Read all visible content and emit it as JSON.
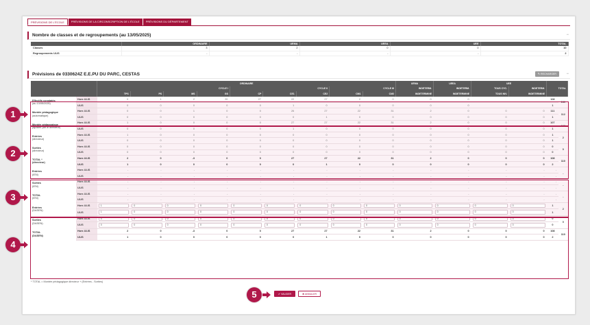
{
  "tabs": [
    {
      "label": "Prévisions de l'école"
    },
    {
      "label": "Prévisions de la circonscription de l'école"
    },
    {
      "label": "Prévisions du département"
    }
  ],
  "section1": {
    "title": "Nombre de classes et de regroupements (au 13/05/2025)",
    "collapse": "−",
    "columns": [
      "",
      "ORDINAIRE",
      "UEMA",
      "UEEA",
      "UEE",
      "TOTAL"
    ],
    "rows": [
      {
        "label": "Classes",
        "values": [
          "3",
          "2",
          "0",
          "0",
          "10"
        ]
      },
      {
        "label": "Regroupements ULIS",
        "values": [
          "-",
          "-",
          "-",
          "-",
          "2"
        ]
      }
    ]
  },
  "section2": {
    "title": "Prévisions de 0330624Z E.E.PU DU PARC, CESTAS",
    "recharger": "Recharger",
    "collapse": "−",
    "header": {
      "group_top": [
        "ORDINAIRE",
        "UEMA",
        "UEEA",
        "UEE",
        "TOTAL"
      ],
      "cycles": [
        "CYCLE I",
        "CYCLE II",
        "CYCLE III",
        "INDETERM.",
        "INDETERM.",
        "TOUS CYC.",
        "INDETERM."
      ],
      "levels": [
        "TPS",
        "PS",
        "MS",
        "GS",
        "CP",
        "CE1",
        "CE2",
        "CM1",
        "CM2",
        "INDETERMINE",
        "INDETERMINE",
        "TOUS NIV.",
        "INDETERMINE"
      ]
    },
    "rows": {
      "constates": {
        "label": "Effectifs constatés",
        "sublabel": "(au 13/05/2025)",
        "hors": [
          "0",
          "1",
          "2",
          "20",
          "27",
          "22",
          "27",
          "2",
          "0",
          "0",
          "0"
        ],
        "ulis": [
          "0",
          "0",
          "0",
          "0",
          "0",
          "1",
          "0",
          "0",
          "0",
          "0",
          "0"
        ],
        "total_h": "108",
        "total_u": "1",
        "total": "139"
      },
      "auto": {
        "label": "Montée pédagogique",
        "sublabel": "(automatique)",
        "hors": [
          "0",
          "0",
          "1",
          "0",
          "0",
          "26",
          "27",
          "22",
          "31",
          "2",
          "0",
          "0",
          "0"
        ],
        "ulis": [
          "0",
          "0",
          "0",
          "0",
          "0",
          "0",
          "1",
          "0",
          "0",
          "0",
          "0",
          "0",
          "0"
        ],
        "total_h": "111",
        "total_u": "1",
        "total": "112"
      }
    },
    "g2": {
      "montee": {
        "label": "Montée pédagogique",
        "sublabel": "(ajustée par le directeur)",
        "hors": [
          "1",
          "0",
          "0",
          "0",
          "0",
          "27",
          "27",
          "22",
          "31",
          "2",
          "0",
          "0",
          "0"
        ],
        "ulis": [
          "0",
          "0",
          "0",
          "0",
          "0",
          "1",
          "0",
          "0",
          "0",
          "0",
          "0",
          "0",
          "0"
        ],
        "total_h": "107",
        "total_u": "1",
        "total": "108"
      },
      "entrees": {
        "label": "Entrées",
        "sublabel": "(directeur)",
        "hors": [
          "1",
          "0",
          "0",
          "0",
          "0",
          "0",
          "0",
          "0",
          "0",
          "0",
          "0",
          "0",
          "0"
        ],
        "ulis": [
          "0",
          "0",
          "0",
          "0",
          "0",
          "0",
          "0",
          "0",
          "0",
          "0",
          "0",
          "0",
          "0"
        ],
        "total_h": "1",
        "total_u": "1",
        "total": "2"
      },
      "sorties": {
        "label": "Sorties",
        "sublabel": "(directeur)",
        "hors": [
          "0",
          "0",
          "0",
          "0",
          "0",
          "0",
          "0",
          "0",
          "0",
          "0",
          "0",
          "0",
          "0"
        ],
        "ulis": [
          "0",
          "0",
          "0",
          "0",
          "0",
          "0",
          "0",
          "0",
          "0",
          "0",
          "0",
          "0",
          "0"
        ],
        "total_h": "0",
        "total_u": "0",
        "total": "0"
      },
      "total": {
        "label": "TOTAL *",
        "sublabel": "(directeur)",
        "hors": [
          "2",
          "0",
          "-3",
          "0",
          "0",
          "27",
          "27",
          "22",
          "31",
          "2",
          "0",
          "0",
          "0"
        ],
        "ulis": [
          "1",
          "0",
          "0",
          "0",
          "0",
          "0",
          "1",
          "0",
          "0",
          "0",
          "0",
          "0",
          "0"
        ],
        "total_h": "108",
        "total_u": "2",
        "total": "110"
      }
    },
    "g3": {
      "rows": [
        {
          "label": "Entrées",
          "sublabel": "(IEN)"
        },
        {
          "label": "Sorties",
          "sublabel": "(IEN)"
        },
        {
          "label": "TOTAL",
          "sublabel": "(IEN)"
        }
      ],
      "dash": "-"
    },
    "g4": {
      "entrees": {
        "label": "Entrées",
        "sublabel": "(DASEN)",
        "hors": [
          "1",
          "0",
          "0",
          "0",
          "0",
          "0",
          "0",
          "0",
          "0",
          "0",
          "0",
          "0",
          "0"
        ],
        "ulis": [
          "1",
          "0",
          "0",
          "0",
          "0",
          "0",
          "0",
          "0",
          "0",
          "0",
          "0",
          "0",
          "0"
        ],
        "total_h": "1",
        "total_u": "1",
        "total": "2"
      },
      "sorties": {
        "label": "Sorties",
        "sublabel": "(DASEN)",
        "hors": [
          "0",
          "0",
          "0",
          "0",
          "0",
          "0",
          "0",
          "0",
          "0",
          "0",
          "0",
          "0",
          "0"
        ],
        "ulis": [
          "0",
          "0",
          "0",
          "0",
          "0",
          "0",
          "0",
          "0",
          "0",
          "0",
          "0",
          "0",
          "0"
        ],
        "total_h": "0",
        "total_u": "0",
        "total": "0"
      },
      "total": {
        "label": "TOTAL",
        "sublabel": "(DASEN)",
        "hors": [
          "2",
          "0",
          "-3",
          "0",
          "0",
          "27",
          "27",
          "22",
          "31",
          "2",
          "0",
          "0",
          "0"
        ],
        "ulis": [
          "1",
          "0",
          "0",
          "0",
          "0",
          "0",
          "1",
          "0",
          "0",
          "0",
          "0",
          "0",
          "0"
        ],
        "total_h": "108",
        "total_u": "2",
        "total": "110"
      }
    },
    "hors_ulis": "Hors ULIS",
    "ulis": "ULIS"
  },
  "footnote": "* TOTAL = Montée pédagogique directeur + (Entrées - Sorties)",
  "actions": {
    "validate": "Valider",
    "cancel": "Annuler"
  },
  "bubbles": [
    "1",
    "2",
    "3",
    "4",
    "5"
  ],
  "colors": {
    "accent": "#b0184a",
    "header": "#5a5a5a",
    "rowbg": "#fbf1f5"
  }
}
